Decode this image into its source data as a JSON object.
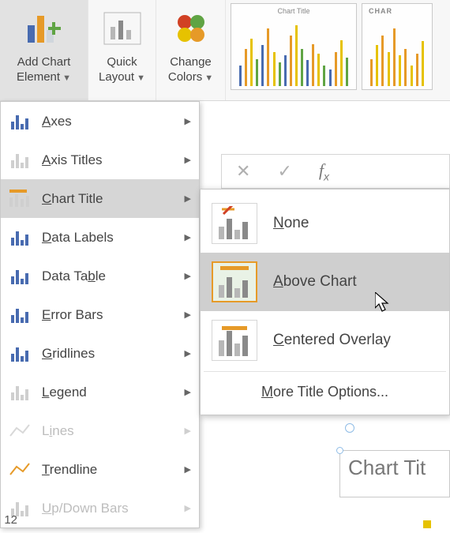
{
  "ribbon": {
    "add_chart_element": "Add Chart\nElement",
    "quick_layout": "Quick\nLayout",
    "change_colors": "Change\nColors",
    "thumb1_title": "Chart Title",
    "thumb2_title": "CHAR"
  },
  "formula": {
    "cancel": "✕",
    "accept": "✓",
    "fx": "fx"
  },
  "menu": {
    "axes": "Axes",
    "axis_titles": "Axis Titles",
    "chart_title": "Chart Title",
    "data_labels": "Data Labels",
    "data_table": "Data Table",
    "error_bars": "Error Bars",
    "gridlines": "Gridlines",
    "legend": "Legend",
    "lines": "Lines",
    "trendline": "Trendline",
    "updown_bars": "Up/Down Bars"
  },
  "submenu": {
    "none": "None",
    "above_chart": "Above Chart",
    "centered_overlay": "Centered Overlay",
    "more": "More Title Options..."
  },
  "sheet": {
    "row_number": "12",
    "chart_title_text": "Chart Tit"
  }
}
